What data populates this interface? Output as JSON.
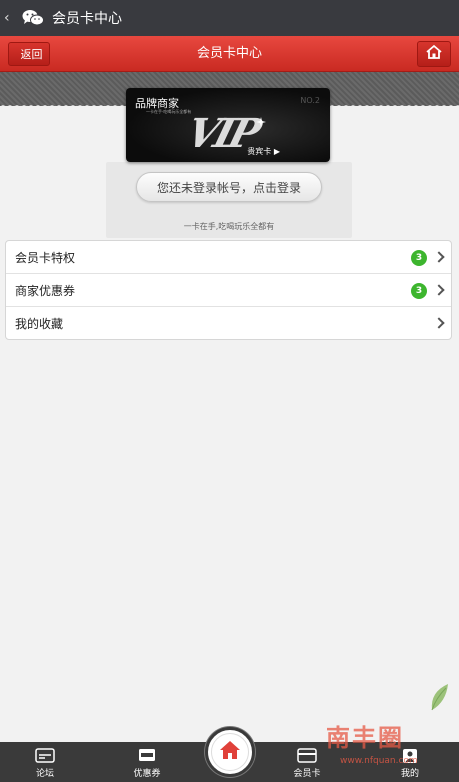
{
  "wechat_bar": {
    "back": "‹",
    "title": "会员卡中心",
    "icon": "wechat-logo-icon"
  },
  "header": {
    "back_label": "返回",
    "title": "会员卡中心",
    "home_icon": "home-icon",
    "accent": "#d9342c"
  },
  "card": {
    "brand": "品牌商家",
    "brand_sub": "一卡在手·吃喝玩乐全都有",
    "corner": "NO.2",
    "logo": "VIP",
    "label": "贵宾卡 ▶",
    "login_button": "您还未登录帐号，点击登录",
    "slogan": "一卡在手,吃喝玩乐全都有"
  },
  "menu": {
    "items": [
      {
        "label": "会员卡特权",
        "badge": "3"
      },
      {
        "label": "商家优惠券",
        "badge": "3"
      },
      {
        "label": "我的收藏",
        "badge": ""
      }
    ]
  },
  "tabbar": {
    "tabs": [
      {
        "label": "论坛",
        "icon": "forum-icon"
      },
      {
        "label": "优惠券",
        "icon": "coupon-icon"
      },
      {
        "label": "会员卡",
        "icon": "card-icon"
      },
      {
        "label": "我的",
        "icon": "profile-icon"
      }
    ],
    "center_icon": "home-icon"
  },
  "watermark": {
    "text": "南丰圈",
    "url": "www.nfquan.com"
  }
}
